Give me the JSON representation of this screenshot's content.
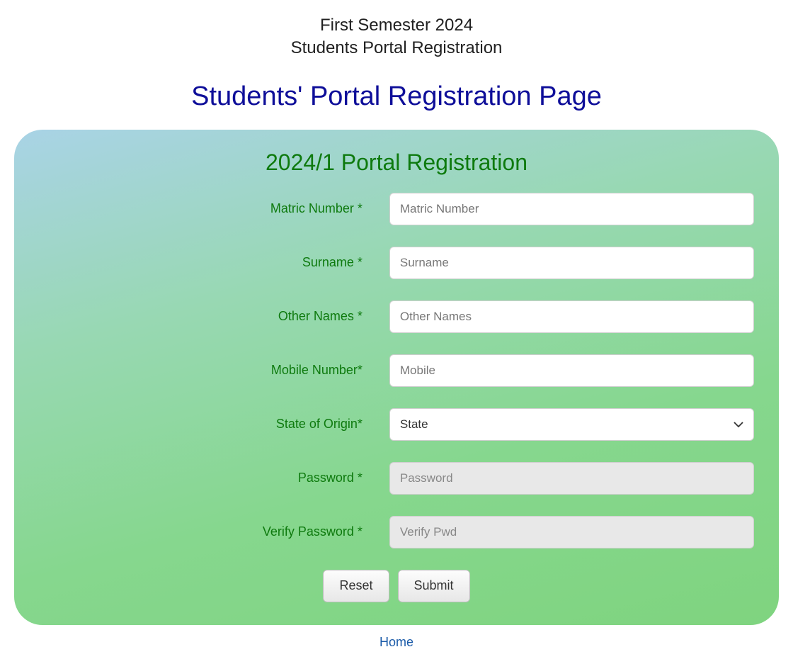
{
  "header": {
    "line1": "First Semester 2024",
    "line2": "Students Portal Registration"
  },
  "page_heading": "Students' Portal Registration Page",
  "form": {
    "title": "2024/1 Portal Registration",
    "fields": {
      "matric": {
        "label": "Matric Number *",
        "placeholder": "Matric Number"
      },
      "surname": {
        "label": "Surname *",
        "placeholder": "Surname"
      },
      "othernames": {
        "label": "Other Names *",
        "placeholder": "Other Names"
      },
      "mobile": {
        "label": "Mobile Number*",
        "placeholder": "Mobile"
      },
      "state": {
        "label": "State of Origin*",
        "selected": "State"
      },
      "password": {
        "label": "Password *",
        "placeholder": "Password"
      },
      "verify_password": {
        "label": "Verify Password *",
        "placeholder": "Verify Pwd"
      }
    },
    "buttons": {
      "reset": "Reset",
      "submit": "Submit"
    }
  },
  "footer": {
    "home_link": "Home"
  }
}
